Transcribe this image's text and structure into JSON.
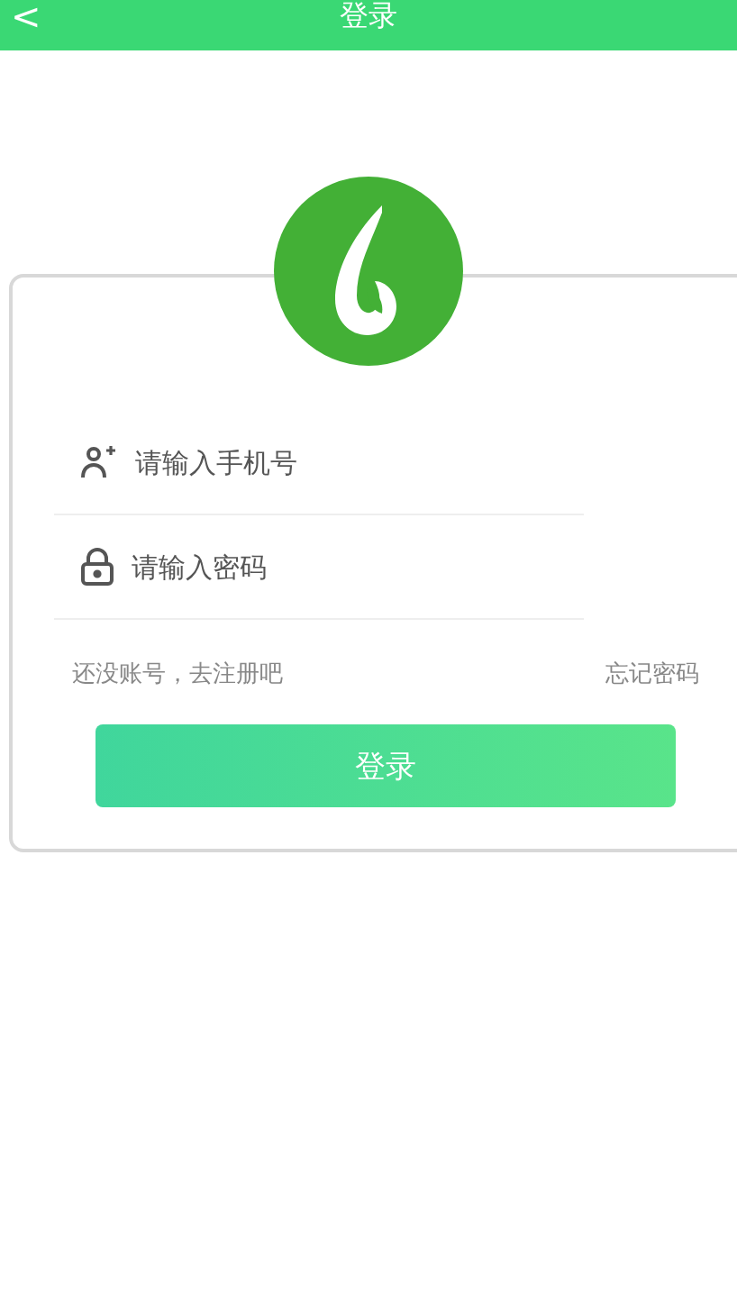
{
  "header": {
    "back": "<",
    "title": "登录"
  },
  "fields": [
    {
      "kind": "phone",
      "placeholder": "请输入手机号"
    },
    {
      "kind": "password",
      "placeholder": "请输入密码"
    }
  ],
  "links": {
    "register": "还没账号，去注册吧",
    "forgot": "忘记密码"
  },
  "submit": "登录"
}
